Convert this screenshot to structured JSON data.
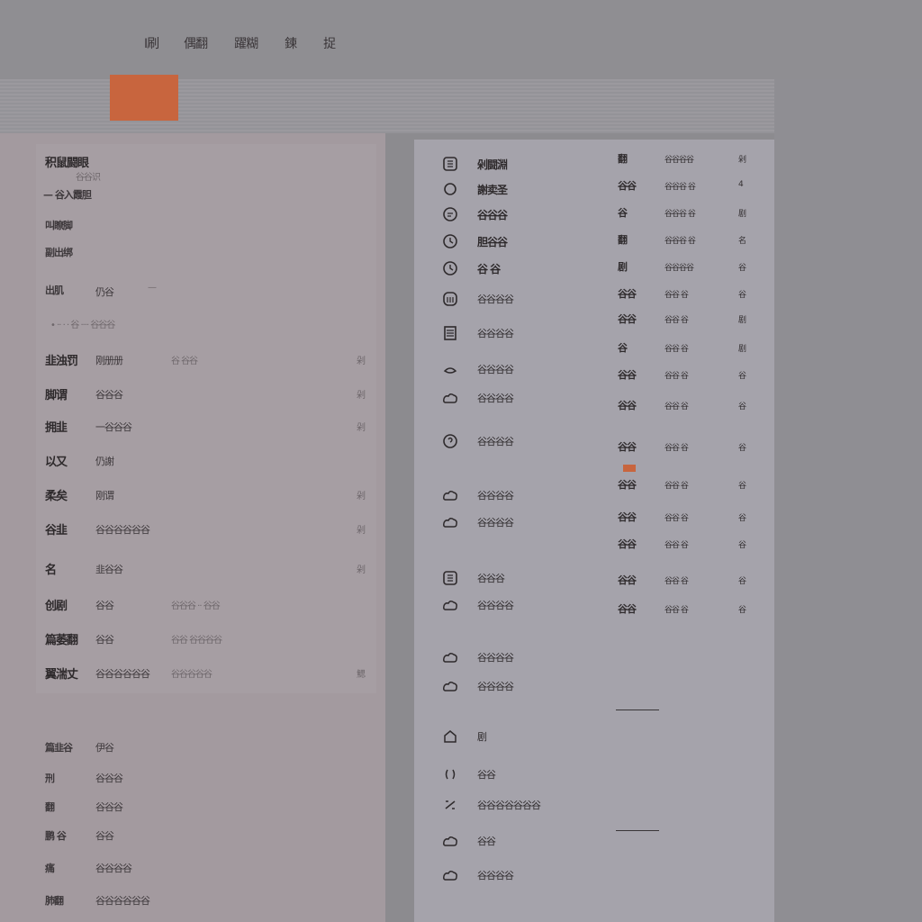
{
  "colors": {
    "accent": "#c8653e",
    "background": "#8c8b8f",
    "panel": "#a39a9f"
  },
  "top_nav": [
    "I刷",
    "偶翻",
    "躍糊",
    "鍊",
    "捉"
  ],
  "left": {
    "header": {
      "title": "积鼠闘眼",
      "subtitle": "谷谷识",
      "line1": "— 谷入霞胆",
      "line2": "叫瞭脚",
      "line3": "副出绑"
    },
    "hint": {
      "label": "出肌",
      "value": "仍谷",
      "dash": "—"
    },
    "bullet_text": "• ·· · · 谷 ···· 谷谷谷",
    "rows": [
      {
        "a": "韭浊罚",
        "b": "刚册册",
        "c": "谷 谷谷",
        "d": "剁"
      },
      {
        "a": "脚谓",
        "b": "谷谷谷",
        "c": "",
        "d": "剁"
      },
      {
        "a": "拥韭",
        "b": "一谷谷谷",
        "c": "",
        "d": "剁"
      },
      {
        "a": "以又",
        "b": "仍謝",
        "c": "",
        "d": ""
      },
      {
        "a": "柔矣",
        "b": "刚谓",
        "c": "",
        "d": "剁"
      },
      {
        "a": "谷韭",
        "b": "谷谷谷谷谷谷",
        "c": "",
        "d": "剁"
      },
      {
        "a": "名",
        "b": "韭谷谷",
        "c": "",
        "d": "剁"
      },
      {
        "a": "创剧",
        "b": "谷谷",
        "c": "谷谷谷 ·· 谷谷",
        "d": ""
      },
      {
        "a": "篇萎翻",
        "b": "谷谷",
        "c": "谷谷 谷谷谷谷",
        "d": ""
      },
      {
        "a": "翼湍丈",
        "b": "谷谷谷谷谷谷",
        "c": "谷谷谷谷谷",
        "d": "鰓"
      }
    ],
    "bottom": [
      {
        "a": "篇韭谷",
        "b": "伊谷"
      },
      {
        "a": "刑",
        "b": "谷谷谷"
      },
      {
        "a": "翻",
        "b": "谷谷谷"
      },
      {
        "a": "鹏 谷",
        "b": "谷谷"
      },
      {
        "a": "痛",
        "b": "谷谷谷谷"
      },
      {
        "a": "肺翻",
        "b": "谷谷谷谷谷谷"
      }
    ]
  },
  "right": {
    "items": [
      {
        "icon": "grid-icon",
        "label": "剁闘淵"
      },
      {
        "icon": "circle-icon",
        "label": "謝卖圣"
      },
      {
        "icon": "chat-icon",
        "label": "谷谷谷"
      },
      {
        "icon": "clock-icon",
        "label": "胆谷谷"
      },
      {
        "icon": "clock-icon",
        "label": "谷 谷"
      },
      {
        "icon": "building-icon",
        "label": "谷谷谷谷"
      },
      {
        "icon": "document-icon",
        "label": "谷谷谷谷"
      },
      {
        "icon": "hand-icon",
        "label": "谷谷谷谷"
      },
      {
        "icon": "cloud-icon",
        "label": "谷谷谷谷"
      },
      {
        "icon": "help-icon",
        "label": "谷谷谷谷"
      },
      {
        "icon": "cloud-icon",
        "label": "谷谷谷谷"
      },
      {
        "icon": "cloud-icon",
        "label": "谷谷谷谷"
      },
      {
        "icon": "grid-icon",
        "label": "谷谷谷"
      },
      {
        "icon": "cloud-icon",
        "label": "谷谷谷谷"
      },
      {
        "icon": "cloud-icon",
        "label": "谷谷谷谷"
      },
      {
        "icon": "cloud-icon",
        "label": "谷谷谷谷"
      },
      {
        "icon": "home-icon",
        "label": "剧"
      },
      {
        "icon": "bracket-icon",
        "label": "谷谷"
      },
      {
        "icon": "link-icon",
        "label": "谷谷谷谷谷谷谷"
      },
      {
        "icon": "cloud-icon",
        "label": "谷谷"
      },
      {
        "icon": "cloud-icon",
        "label": "谷谷谷谷"
      }
    ],
    "table": [
      {
        "a": "翻",
        "b": "谷谷谷谷",
        "c": "剁"
      },
      {
        "a": "谷谷",
        "b": "谷谷谷 谷",
        "c": "4"
      },
      {
        "a": "谷",
        "b": "谷谷谷 谷",
        "c": "剧"
      },
      {
        "a": "翻",
        "b": "谷谷谷 谷",
        "c": "名"
      },
      {
        "a": "剧",
        "b": "谷谷谷谷",
        "c": "谷"
      },
      {
        "a": "谷谷",
        "b": "谷谷 谷",
        "c": "谷"
      },
      {
        "a": "谷谷",
        "b": "谷谷 谷",
        "c": "剧"
      },
      {
        "a": "谷",
        "b": "谷谷 谷",
        "c": "剧"
      },
      {
        "a": "谷谷",
        "b": "谷谷 谷",
        "c": "谷"
      },
      {
        "a": "谷谷",
        "b": "谷谷 谷",
        "c": "谷"
      },
      {
        "a": "谷谷",
        "b": "谷谷 谷",
        "c": "谷"
      },
      {
        "a": "谷谷",
        "b": "谷谷 谷",
        "c": "谷"
      },
      {
        "a": "谷谷",
        "b": "谷谷 谷",
        "c": "谷"
      },
      {
        "a": "谷谷",
        "b": "谷谷 谷",
        "c": "谷"
      },
      {
        "a": "谷谷",
        "b": "谷谷 谷",
        "c": "谷"
      },
      {
        "a": "谷谷",
        "b": "谷谷 谷",
        "c": "谷"
      }
    ]
  }
}
